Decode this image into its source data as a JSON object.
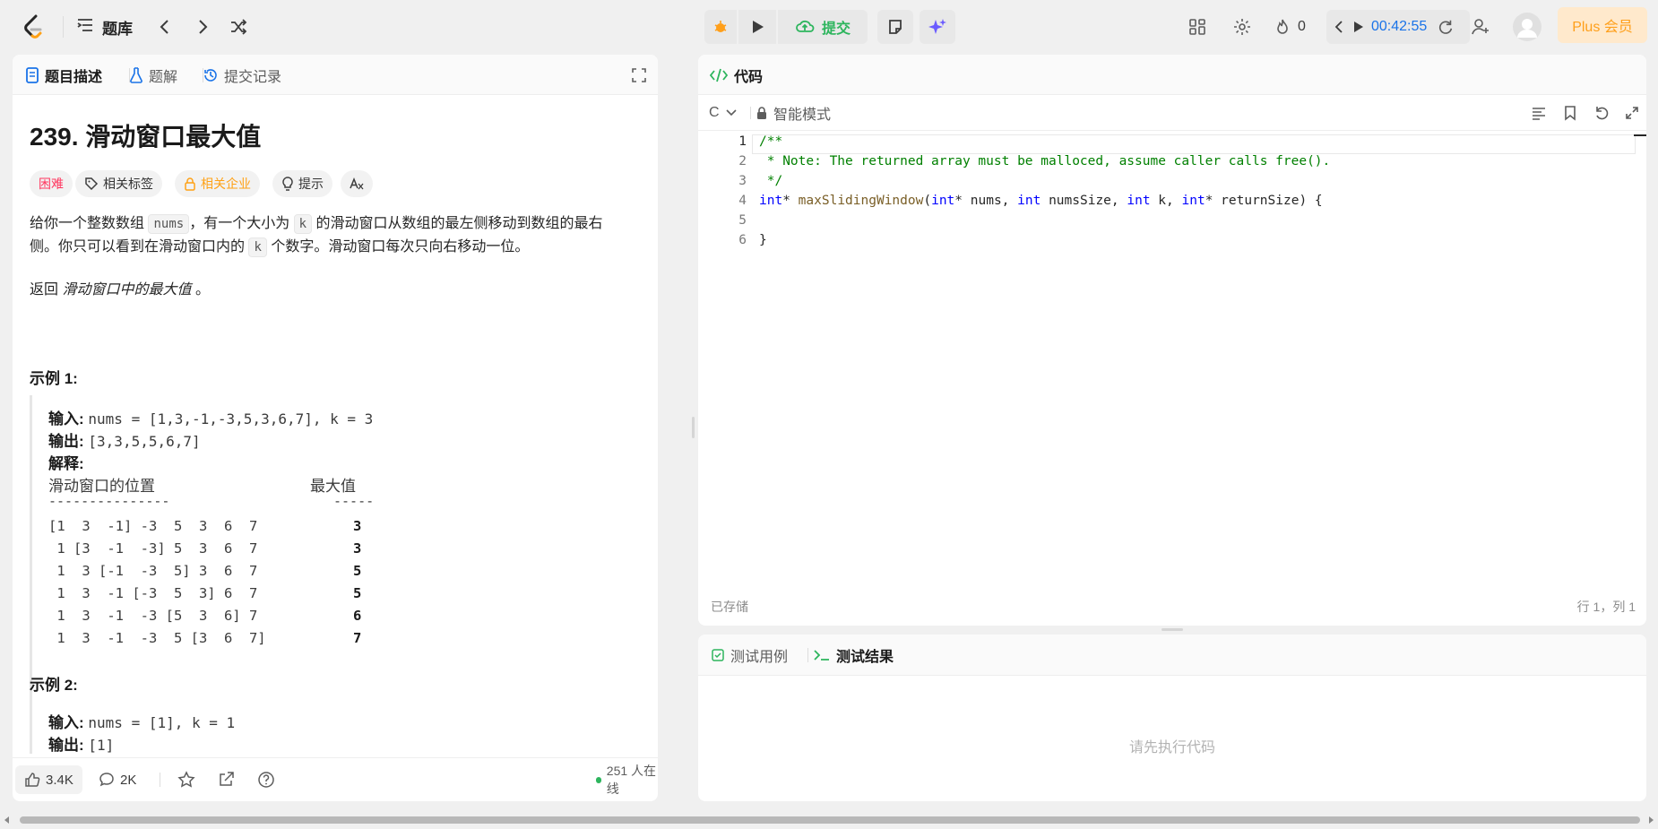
{
  "topbar": {
    "problem_list_label": "题库",
    "submit_label": "提交",
    "streak_count": "0",
    "timer": "00:42:55",
    "plus_label": "Plus 会员"
  },
  "left_panel": {
    "tabs": [
      {
        "label": "题目描述"
      },
      {
        "label": "题解"
      },
      {
        "label": "提交记录"
      }
    ],
    "title": "239. 滑动窗口最大值",
    "tags": {
      "difficulty": "困难",
      "related_tags": "相关标签",
      "companies": "相关企业",
      "hint": "提示"
    },
    "desc_p1_a": "给你一个整数数组",
    "desc_code_nums": "nums",
    "desc_p1_b": "，有一个大小为",
    "desc_code_k": "k",
    "desc_p1_c": "的滑动窗口从数组的最左侧移动到数组的最右",
    "desc_p1_d": "侧。你只可以看到在滑动窗口内的",
    "desc_p1_e": "个数字。滑动窗口每次只向右移动一位。",
    "desc_p2_a": "返回",
    "desc_p2_b": "滑动窗口中的最大值",
    "desc_p2_c": "。",
    "example1": {
      "heading": "示例 1:",
      "input_label": "输入:",
      "input_value": "nums = [1,3,-1,-3,5,3,6,7], k = 3",
      "output_label": "输出:",
      "output_value": "[3,3,5,5,6,7]",
      "explain_label": "解释:",
      "col_window": "滑动窗口的位置",
      "col_max": "最大值",
      "rule_window": "---------------",
      "rule_max": "-----",
      "rows": [
        {
          "window": "[1  3  -1] -3  5  3  6  7",
          "max": "3"
        },
        {
          "window": " 1 [3  -1  -3] 5  3  6  7",
          "max": "3"
        },
        {
          "window": " 1  3 [-1  -3  5] 3  6  7",
          "max": "5"
        },
        {
          "window": " 1  3  -1 [-3  5  3] 6  7",
          "max": "5"
        },
        {
          "window": " 1  3  -1  -3 [5  3  6] 7",
          "max": "6"
        },
        {
          "window": " 1  3  -1  -3  5 [3  6  7]",
          "max": "7"
        }
      ]
    },
    "example2": {
      "heading": "示例 2:",
      "input_label": "输入:",
      "input_value": "nums = [1], k = 1",
      "output_label": "输出:",
      "output_value": "[1]"
    },
    "footer": {
      "likes": "3.4K",
      "comments": "2K",
      "online": "251 人在线"
    }
  },
  "code_panel": {
    "tab_label": "代码",
    "language": "C",
    "mode": "智能模式",
    "saved_status": "已存储",
    "cursor_pos": "行 1，列 1"
  },
  "test_panel": {
    "tab_cases": "测试用例",
    "tab_results": "测试结果",
    "placeholder": "请先执行代码"
  },
  "colors": {
    "accent_blue": "#1a73e8",
    "submit_green": "#2db55d",
    "difficulty_red": "#ff375f",
    "plus_orange": "#ff9f1a",
    "online_green": "#2db55d"
  }
}
